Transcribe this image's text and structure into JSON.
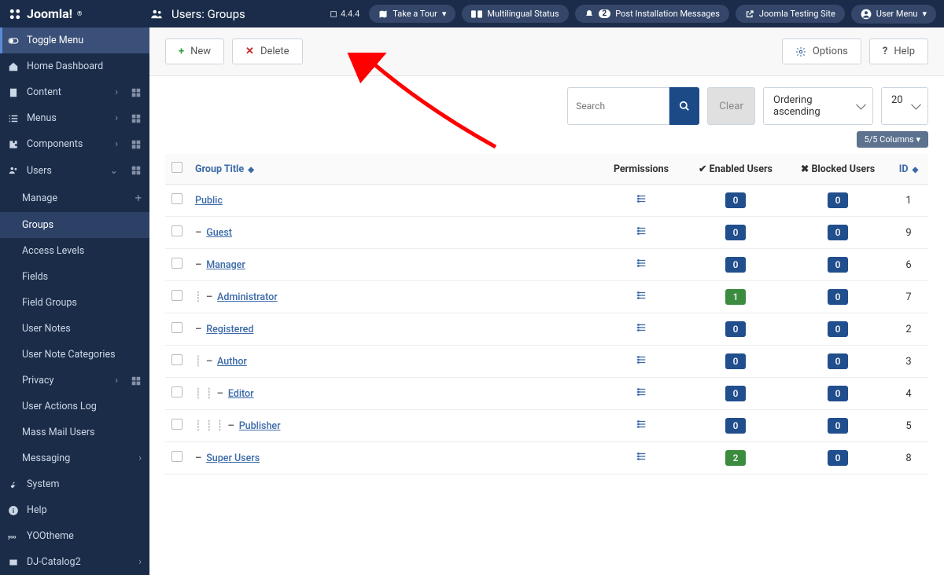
{
  "brand": "Joomla!",
  "page_title": "Users: Groups",
  "version": "4.4.4",
  "topbar": {
    "tour": "Take a Tour",
    "multilingual": "Multilingual Status",
    "postinstall": "Post Installation Messages",
    "postinstall_count": "2",
    "testing": "Joomla Testing Site",
    "usermenu": "User Menu"
  },
  "sidebar": {
    "toggle": "Toggle Menu",
    "items": [
      {
        "label": "Home Dashboard",
        "icon": "home"
      },
      {
        "label": "Content",
        "icon": "file",
        "chev": true,
        "grid": true
      },
      {
        "label": "Menus",
        "icon": "list",
        "chev": true,
        "grid": true
      },
      {
        "label": "Components",
        "icon": "puzzle",
        "chev": true,
        "grid": true
      },
      {
        "label": "Users",
        "icon": "users",
        "chev": true,
        "chev_open": true,
        "grid": true,
        "expanded": true
      }
    ],
    "users_sub": [
      {
        "label": "Manage",
        "plus": true
      },
      {
        "label": "Groups",
        "selected": true
      },
      {
        "label": "Access Levels"
      },
      {
        "label": "Fields"
      },
      {
        "label": "Field Groups"
      },
      {
        "label": "User Notes"
      },
      {
        "label": "User Note Categories"
      },
      {
        "label": "Privacy",
        "chev": true,
        "grid": true
      },
      {
        "label": "User Actions Log"
      },
      {
        "label": "Mass Mail Users"
      },
      {
        "label": "Messaging",
        "chev": true
      }
    ],
    "bottom": [
      {
        "label": "System",
        "icon": "wrench"
      },
      {
        "label": "Help",
        "icon": "info"
      },
      {
        "label": "YOOtheme",
        "icon": "yoo"
      },
      {
        "label": "DJ-Catalog2",
        "icon": "dj",
        "chev": true
      }
    ]
  },
  "toolbar": {
    "new": "New",
    "delete": "Delete",
    "options": "Options",
    "help": "Help"
  },
  "filters": {
    "search_placeholder": "Search",
    "clear": "Clear",
    "ordering": "Ordering ascending",
    "pagesize": "20",
    "columns": "5/5 Columns"
  },
  "table": {
    "headers": {
      "group_title": "Group Title",
      "permissions": "Permissions",
      "enabled": "Enabled Users",
      "blocked": "Blocked Users",
      "id": "ID"
    },
    "rows": [
      {
        "indent": 0,
        "title": "Public",
        "enabled": "0",
        "en_green": false,
        "blocked": "0",
        "id": "1"
      },
      {
        "indent": 1,
        "title": "Guest",
        "enabled": "0",
        "en_green": false,
        "blocked": "0",
        "id": "9"
      },
      {
        "indent": 1,
        "title": "Manager",
        "enabled": "0",
        "en_green": false,
        "blocked": "0",
        "id": "6"
      },
      {
        "indent": 2,
        "title": "Administrator",
        "enabled": "1",
        "en_green": true,
        "blocked": "0",
        "id": "7"
      },
      {
        "indent": 1,
        "title": "Registered",
        "enabled": "0",
        "en_green": false,
        "blocked": "0",
        "id": "2"
      },
      {
        "indent": 2,
        "title": "Author",
        "enabled": "0",
        "en_green": false,
        "blocked": "0",
        "id": "3"
      },
      {
        "indent": 3,
        "title": "Editor",
        "enabled": "0",
        "en_green": false,
        "blocked": "0",
        "id": "4"
      },
      {
        "indent": 4,
        "title": "Publisher",
        "enabled": "0",
        "en_green": false,
        "blocked": "0",
        "id": "5"
      },
      {
        "indent": 1,
        "title": "Super Users",
        "enabled": "2",
        "en_green": true,
        "blocked": "0",
        "id": "8"
      }
    ]
  }
}
